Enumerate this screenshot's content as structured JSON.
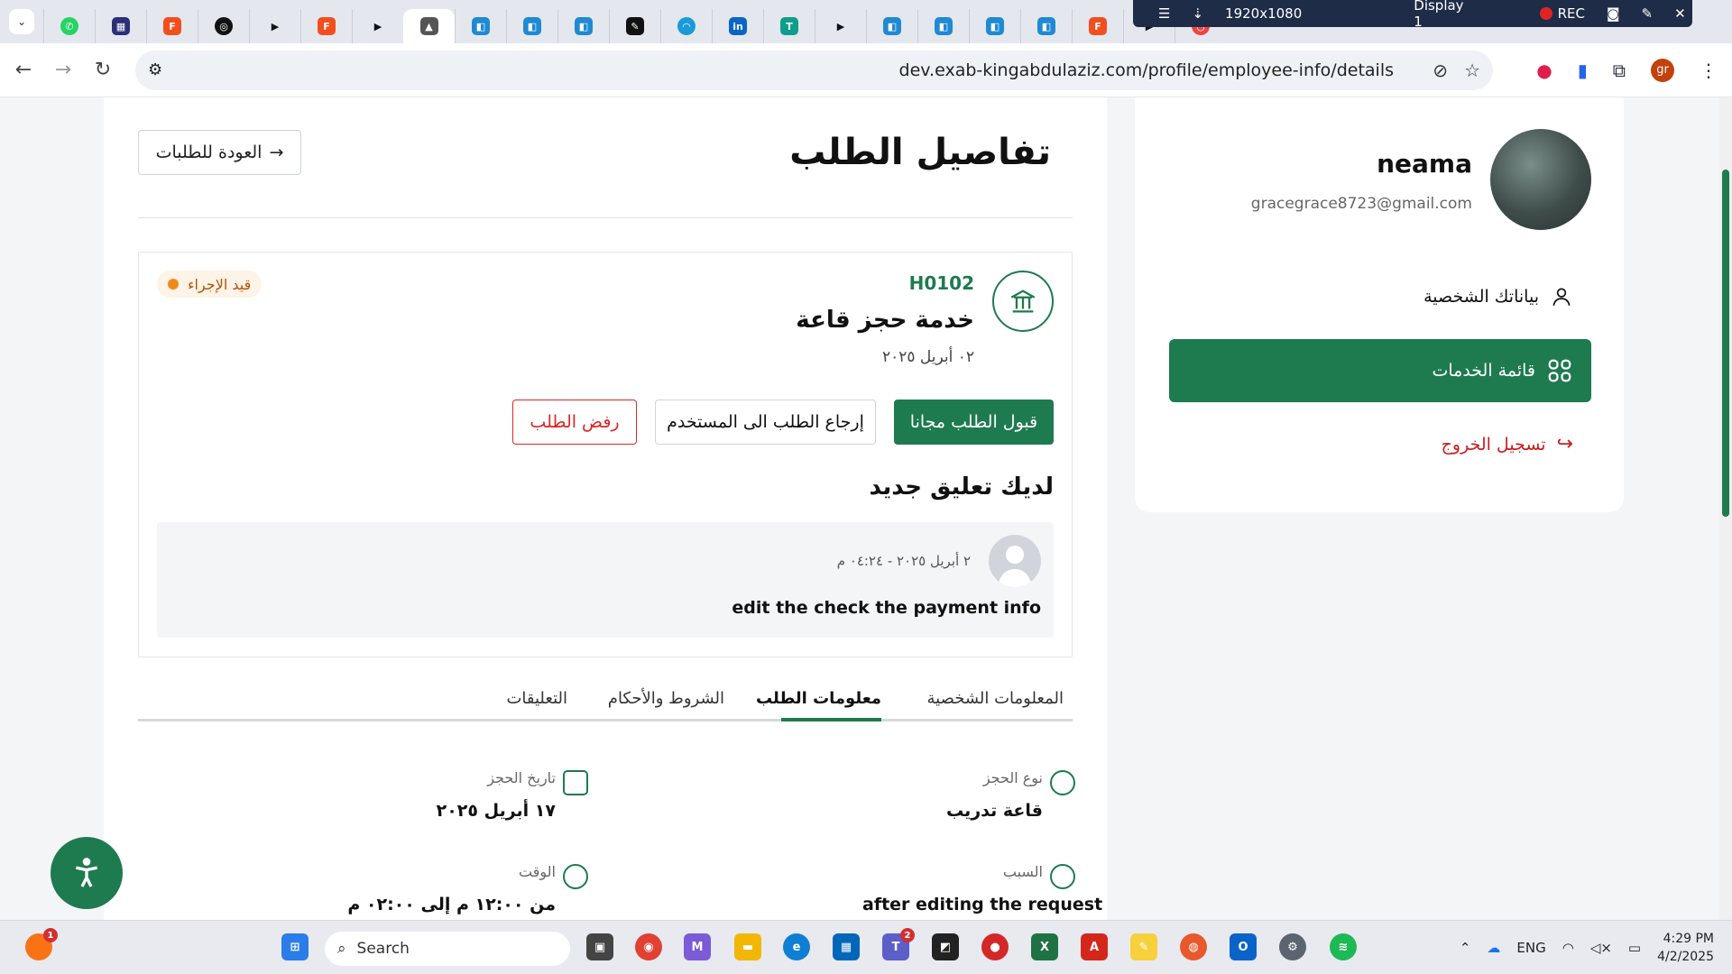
{
  "browser": {
    "url": "dev.exab-kingabdulaziz.com/profile/employee-info/details",
    "tab_favicons": [
      "whatsapp",
      "gem",
      "figma",
      "openai",
      "play",
      "figma",
      "play",
      "exab",
      "vscode",
      "vscode",
      "vscode",
      "pen",
      "chart",
      "linkedin",
      "tau",
      "play",
      "vscode",
      "vscode",
      "vscode",
      "vscode",
      "figma",
      "play",
      "chrome"
    ],
    "recorder": {
      "resolution": "1920x1080",
      "display": "Display 1",
      "rec_label": "REC"
    },
    "profile_initials": "gr"
  },
  "header": {
    "title": "تفاصيل الطلب",
    "back_button": "العودة للطلبات"
  },
  "request": {
    "code": "H0102",
    "service_name": "خدمة حجز قاعة",
    "date": "٠٢ أبريل ٢٠٢٥",
    "status": "قيد الإجراء",
    "actions": {
      "accept": "قبول الطلب مجانا",
      "return": "إرجاع الطلب الى المستخدم",
      "reject": "رفض الطلب"
    }
  },
  "comment": {
    "heading": "لديك تعليق جديد",
    "meta": "٢ أبريل ٢٠٢٥ - ٠٤:٢٤ م",
    "text": "edit the check the payment info"
  },
  "tabs": [
    {
      "label": "المعلومات الشخصية",
      "active": false
    },
    {
      "label": "معلومات الطلب",
      "active": true
    },
    {
      "label": "الشروط والأحكام",
      "active": false
    },
    {
      "label": "التعليقات",
      "active": false
    }
  ],
  "details": {
    "booking_type": {
      "label": "نوع الحجز",
      "value": "قاعة تدريب"
    },
    "booking_date": {
      "label": "تاريخ الحجز",
      "value": "١٧ أبريل ٢٠٢٥"
    },
    "reason": {
      "label": "السبب",
      "value": "after editing the request"
    },
    "time": {
      "label": "الوقت",
      "value": "من ١٢:٠٠ م إلى ٠٢:٠٠ م"
    }
  },
  "sidebar": {
    "name": "neama",
    "email": "gracegrace8723@gmail.com",
    "personal_data": "بياناتك الشخصية",
    "services_list": "قائمة الخدمات",
    "logout": "تسجيل الخروج"
  },
  "taskbar": {
    "search_placeholder": "Search",
    "language": "ENG",
    "time": "4:29 PM",
    "date": "4/2/2025",
    "notification_count": "1",
    "teams_badge": "2"
  },
  "colors": {
    "primary": "#1e7a4f",
    "danger": "#dc2626",
    "status_orange": "#f08a1c"
  }
}
